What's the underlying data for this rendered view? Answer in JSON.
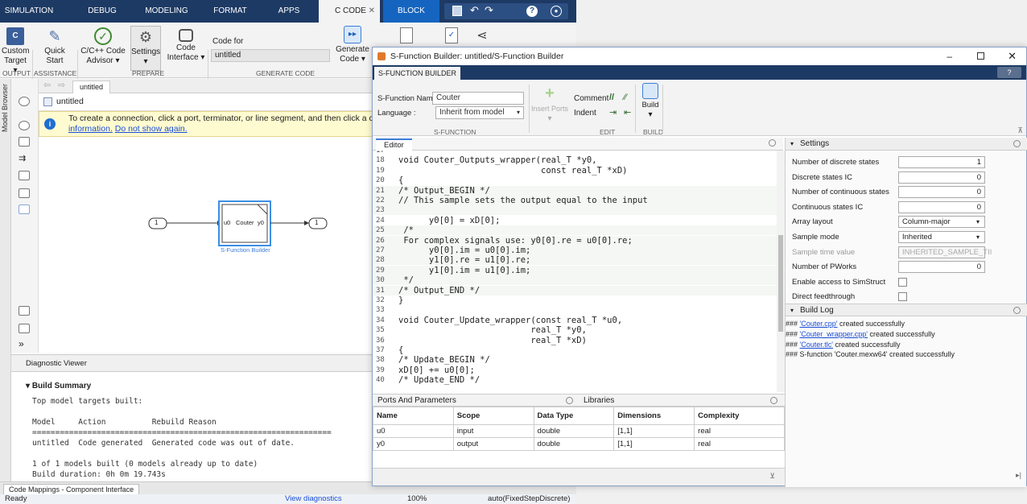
{
  "tabs": [
    "SIMULATION",
    "DEBUG",
    "MODELING",
    "FORMAT",
    "APPS",
    "C CODE",
    "BLOCK"
  ],
  "ribbon": {
    "output_label": "Custom Target",
    "quick_start": "Quick Start",
    "advisor": "C/C++ Code Advisor",
    "settings": "Settings",
    "code_interface": "Code Interface",
    "code_for": "Code for",
    "code_for_value": "untitled",
    "generate_code": "Generate Code",
    "groups": [
      "OUTPUT",
      "ASSISTANCE",
      "PREPARE",
      "GENERATE CODE"
    ]
  },
  "sim": {
    "model_browser": "Model Browser",
    "crumb": "untitled",
    "address": "untitled",
    "notice": "To create a connection, click a port, terminator, or line segment, and then click a compatib",
    "notice_link1": "information.",
    "notice_link2": "Do not show again.",
    "block_name": "Couter",
    "block_label": "S-Function Builder",
    "port_in": "u0",
    "port_out": "y0",
    "inport": "1",
    "outport": "1",
    "diag": "Diagnostic Viewer",
    "build_summary": "Build Summary",
    "build_text": "Top model targets built:\n\nModel     Action          Rebuild Reason\n=================================================================\nuntitled  Code generated  Generated code was out of date.\n\n1 of 1 models built (0 models already up to date)\nBuild duration: 0h 0m 19.743s",
    "code_mappings": "Code Mappings - Component Interface",
    "status_ready": "Ready",
    "status_view": "View diagnostics",
    "status_zoom": "100%",
    "status_solver": "auto(FixedStepDiscrete)"
  },
  "sfb": {
    "title": "S-Function Builder: untitled/S-Function Builder",
    "tab": "S-FUNCTION BUILDER",
    "name_label": "S-Function Name :",
    "name_value": "Couter",
    "lang_label": "Language :",
    "lang_value": "Inherit from model",
    "insert_ports": "Insert Ports",
    "comment": "Comment",
    "indent": "Indent",
    "build": "Build",
    "group_sfunction": "S-FUNCTION",
    "group_edit": "EDIT",
    "group_build": "BUILD",
    "editor_tab": "Editor",
    "ports_tab": "Ports And Parameters",
    "libraries_tab": "Libraries",
    "settings_title": "Settings",
    "buildlog_title": "Build Log"
  },
  "code_lines": [
    {
      "n": "17",
      "t": ""
    },
    {
      "n": "18",
      "t": "void Couter_Outputs_wrapper(real_T *y0,"
    },
    {
      "n": "19",
      "t": "                            const real_T *xD)"
    },
    {
      "n": "20",
      "t": "{"
    },
    {
      "n": "21",
      "t": "/* Output_BEGIN */"
    },
    {
      "n": "22",
      "t": "// This sample sets the output equal to the input"
    },
    {
      "n": "23",
      "t": ""
    },
    {
      "n": "24",
      "t": "      y0[0] = xD[0];"
    },
    {
      "n": "25",
      "t": " /*"
    },
    {
      "n": "26",
      "t": " For complex signals use: y0[0].re = u0[0].re;"
    },
    {
      "n": "27",
      "t": "      y0[0].im = u0[0].im;"
    },
    {
      "n": "28",
      "t": "      y1[0].re = u1[0].re;"
    },
    {
      "n": "29",
      "t": "      y1[0].im = u1[0].im;"
    },
    {
      "n": "30",
      "t": " */"
    },
    {
      "n": "31",
      "t": "/* Output_END */"
    },
    {
      "n": "32",
      "t": "}"
    },
    {
      "n": "33",
      "t": ""
    },
    {
      "n": "34",
      "t": "void Couter_Update_wrapper(const real_T *u0,"
    },
    {
      "n": "35",
      "t": "                          real_T *y0,"
    },
    {
      "n": "36",
      "t": "                          real_T *xD)"
    },
    {
      "n": "37",
      "t": "{"
    },
    {
      "n": "38",
      "t": "/* Update_BEGIN */"
    },
    {
      "n": "39",
      "t": "xD[0] += u0[0];"
    },
    {
      "n": "40",
      "t": "/* Update_END */"
    }
  ],
  "ports": {
    "headers": [
      "Name",
      "Scope",
      "Data Type",
      "Dimensions",
      "Complexity"
    ],
    "rows": [
      [
        "u0",
        "input",
        "double",
        "[1,1]",
        "real"
      ],
      [
        "y0",
        "output",
        "double",
        "[1,1]",
        "real"
      ]
    ]
  },
  "settings": [
    {
      "label": "Number of discrete states",
      "value": "1",
      "kind": "num"
    },
    {
      "label": "Discrete states IC",
      "value": "0",
      "kind": "num"
    },
    {
      "label": "Number of continuous states",
      "value": "0",
      "kind": "num"
    },
    {
      "label": "Continuous states IC",
      "value": "0",
      "kind": "num"
    },
    {
      "label": "Array layout",
      "value": "Column-major",
      "kind": "select"
    },
    {
      "label": "Sample mode",
      "value": "Inherited",
      "kind": "select"
    },
    {
      "label": "Sample time value",
      "value": "INHERITED_SAMPLE_TII",
      "kind": "disabled"
    },
    {
      "label": "Number of PWorks",
      "value": "0",
      "kind": "num"
    },
    {
      "label": "Enable access to SimStruct",
      "value": "",
      "kind": "check"
    },
    {
      "label": "Direct feedthrough",
      "value": "",
      "kind": "check"
    }
  ],
  "build_log": [
    {
      "pre": "### ",
      "link": "'Couter.cpp'",
      "post": " created successfully"
    },
    {
      "pre": "### ",
      "link": "'Couter_wrapper.cpp'",
      "post": " created successfully"
    },
    {
      "pre": "### ",
      "link": "'Couter.tlc'",
      "post": " created successfully"
    },
    {
      "pre": "### S-function 'Couter.mexw64' created successfully",
      "link": "",
      "post": ""
    }
  ]
}
